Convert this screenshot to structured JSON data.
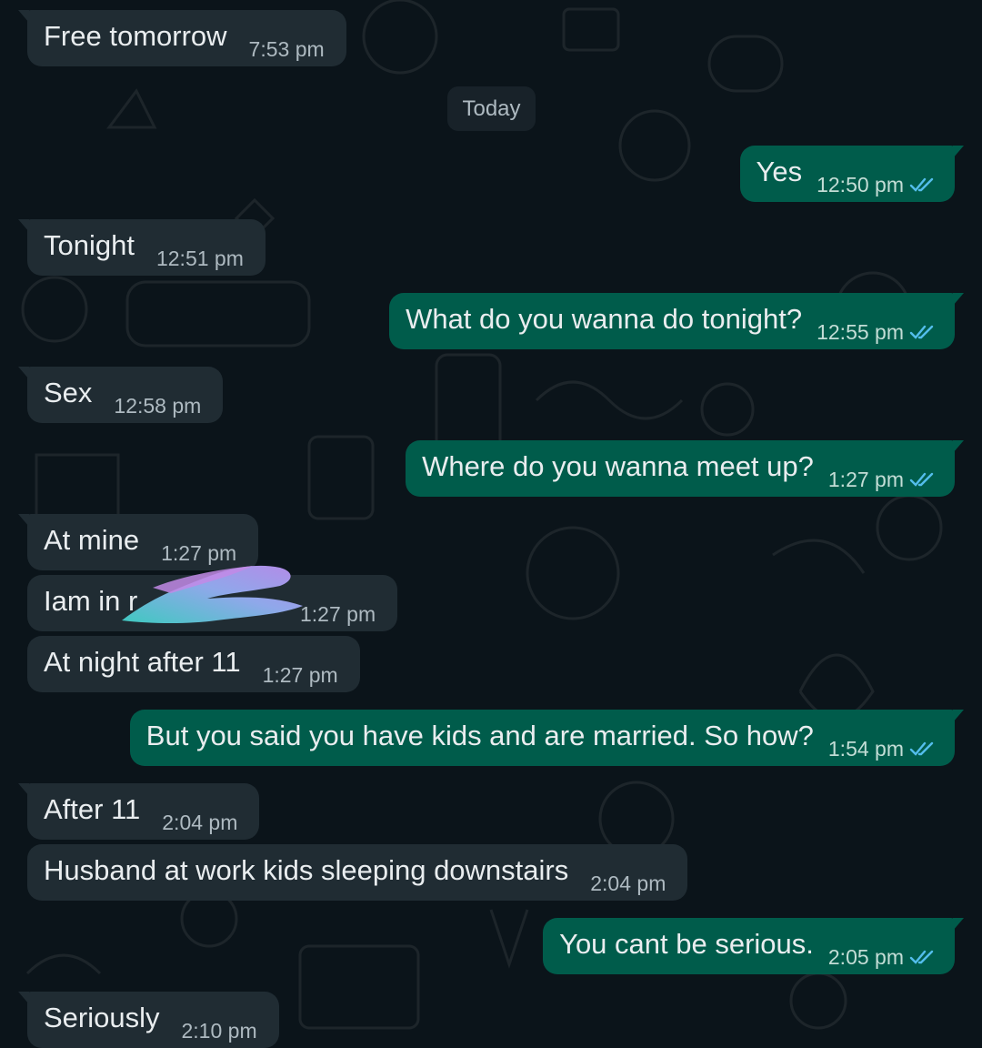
{
  "date_separator": "Today",
  "colors": {
    "background": "#0b141a",
    "incoming_bubble": "#202c33",
    "outgoing_bubble": "#005c4b",
    "read_ticks": "#53bdeb",
    "redaction_scribble": "#a98be8"
  },
  "icons": {
    "read_receipt": "double-check-icon",
    "wallpaper": "doodle-pattern"
  },
  "messages": [
    {
      "dir": "in",
      "text": "Free tomorrow",
      "time": "7:53 pm"
    },
    {
      "dir": "out",
      "text": "Yes",
      "time": "12:50 pm",
      "status": "read"
    },
    {
      "dir": "in",
      "text": "Tonight",
      "time": "12:51 pm"
    },
    {
      "dir": "out",
      "text": "What do you wanna do tonight?",
      "time": "12:55 pm",
      "status": "read"
    },
    {
      "dir": "in",
      "text": "Sex",
      "time": "12:58 pm"
    },
    {
      "dir": "out",
      "text": "Where do you wanna meet up?",
      "time": "1:27 pm",
      "status": "read"
    },
    {
      "dir": "in",
      "text": "At mine",
      "time": "1:27 pm"
    },
    {
      "dir": "in",
      "text": "Iam in r",
      "time": "1:27 pm",
      "redacted": true
    },
    {
      "dir": "in",
      "text": "At night after 11",
      "time": "1:27 pm"
    },
    {
      "dir": "out",
      "text": "But you said you have kids and are married. So how?",
      "time": "1:54 pm",
      "status": "read"
    },
    {
      "dir": "in",
      "text": "After 11",
      "time": "2:04 pm"
    },
    {
      "dir": "in",
      "text": "Husband at work kids sleeping downstairs",
      "time": "2:04 pm"
    },
    {
      "dir": "out",
      "text": "You cant be serious.",
      "time": "2:05 pm",
      "status": "read"
    },
    {
      "dir": "in",
      "text": "Seriously",
      "time": "2:10 pm"
    }
  ]
}
